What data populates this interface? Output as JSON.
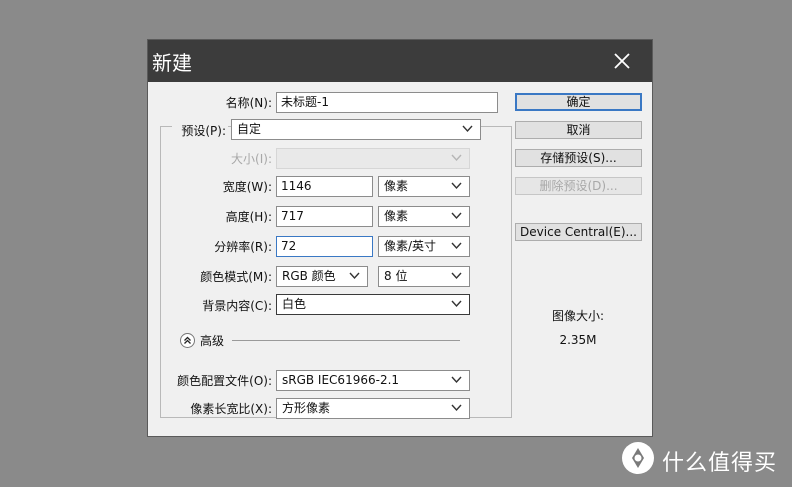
{
  "dialog": {
    "title": "新建",
    "name_label": "名称(N):",
    "name_value": "未标题-1",
    "preset_label": "预设(P):",
    "preset_value": "自定",
    "size_label": "大小(I):",
    "width_label": "宽度(W):",
    "width_value": "1146",
    "width_unit": "像素",
    "height_label": "高度(H):",
    "height_value": "717",
    "height_unit": "像素",
    "resolution_label": "分辨率(R):",
    "resolution_value": "72",
    "resolution_unit": "像素/英寸",
    "color_mode_label": "颜色模式(M):",
    "color_mode_value": "RGB 颜色",
    "bit_depth_value": "8 位",
    "background_label": "背景内容(C):",
    "background_value": "白色",
    "advanced_label": "高级",
    "color_profile_label": "颜色配置文件(O):",
    "color_profile_value": "sRGB IEC61966-2.1",
    "pixel_aspect_label": "像素长宽比(X):",
    "pixel_aspect_value": "方形像素"
  },
  "buttons": {
    "ok": "确定",
    "cancel": "取消",
    "save_preset": "存储预设(S)...",
    "delete_preset": "删除预设(D)...",
    "device_central": "Device Central(E)..."
  },
  "image_size": {
    "label": "图像大小:",
    "value": "2.35M"
  },
  "watermark": {
    "text": "什么值得买"
  },
  "colors": {
    "titlebar": "#3c3c3c",
    "dialog_bg": "#f0f0f0",
    "focus_border": "#3a78c4",
    "desktop": "#8a8a8a"
  }
}
